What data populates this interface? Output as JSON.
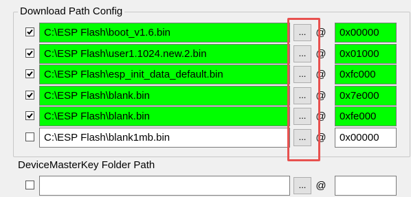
{
  "group": {
    "title": "Download Path Config"
  },
  "colors": {
    "loaded": "#00ff00",
    "empty": "#ffffff",
    "highlight": "#e8514f"
  },
  "rows": [
    {
      "checked": true,
      "path": "C:\\ESP Flash\\boot_v1.6.bin",
      "browse": "...",
      "at": "@",
      "address": "0x00000",
      "loaded": true
    },
    {
      "checked": true,
      "path": "C:\\ESP Flash\\user1.1024.new.2.bin",
      "browse": "...",
      "at": "@",
      "address": "0x01000",
      "loaded": true
    },
    {
      "checked": true,
      "path": "C:\\ESP Flash\\esp_init_data_default.bin",
      "browse": "...",
      "at": "@",
      "address": "0xfc000",
      "loaded": true
    },
    {
      "checked": true,
      "path": "C:\\ESP Flash\\blank.bin",
      "browse": "...",
      "at": "@",
      "address": "0x7e000",
      "loaded": true
    },
    {
      "checked": true,
      "path": "C:\\ESP Flash\\blank.bin",
      "browse": "...",
      "at": "@",
      "address": "0xfe000",
      "loaded": true
    },
    {
      "checked": false,
      "path": "C:\\ESP Flash\\blank1mb.bin",
      "browse": "...",
      "at": "@",
      "address": "0x00000",
      "loaded": false
    }
  ],
  "device_master_key": {
    "label": "DeviceMasterKey Folder Path",
    "checked": false,
    "path": "",
    "browse": "...",
    "at": "@",
    "address": ""
  }
}
